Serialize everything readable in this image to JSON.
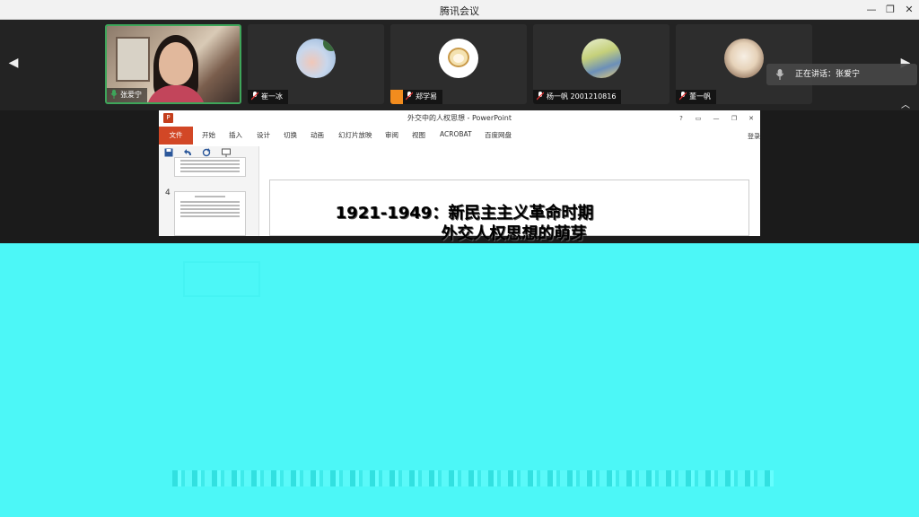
{
  "window": {
    "title": "腾讯会议",
    "minimize_glyph": "—",
    "restore_glyph": "❐",
    "close_glyph": "✕"
  },
  "participants": [
    {
      "name": "张爱宁",
      "active": true,
      "mic": "speaking",
      "avatar": "camera-feed"
    },
    {
      "name": "崔一冰",
      "active": false,
      "mic": "muted",
      "avatar": "sky-photo"
    },
    {
      "name": "郑学易",
      "active": false,
      "mic": "muted",
      "avatar": "cartoon-sheep"
    },
    {
      "name": "杨一帆 2001210816",
      "active": false,
      "mic": "muted",
      "avatar": "anime-figure"
    },
    {
      "name": "董一帆",
      "active": false,
      "mic": "muted",
      "avatar": "cartoon-dog"
    }
  ],
  "speaking_indicator": {
    "text": "正在讲话：张爱宁"
  },
  "nav": {
    "prev": "◀",
    "next": "▶",
    "collapse": "︿"
  },
  "powerpoint": {
    "title": "外交中的人权思想 - PowerPoint",
    "logo_letter": "P",
    "window_buttons": [
      "?",
      "▭",
      "—",
      "❐",
      "✕"
    ],
    "tabs": [
      "文件",
      "开始",
      "插入",
      "设计",
      "切换",
      "动画",
      "幻灯片放映",
      "审阅",
      "视图",
      "ACROBAT",
      "百度网盘"
    ],
    "login": "登录",
    "thumb_number": "4",
    "slide_title_line1": "1921-1949：新民主主义革命时期",
    "slide_title_line2": "外交人权思想的萌芽"
  },
  "colors": {
    "accent_green": "#3ea55a",
    "ppt_orange": "#d24726",
    "glitch_cyan": "#4cf7f7"
  }
}
